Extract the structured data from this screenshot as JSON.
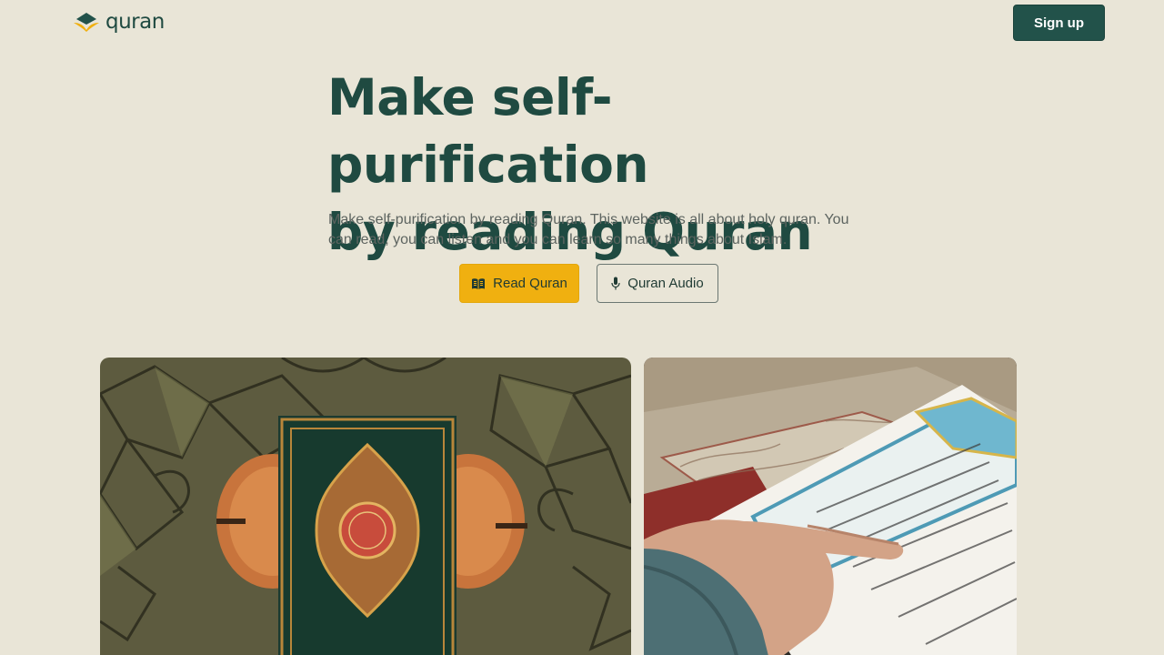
{
  "header": {
    "logo_text": "quran",
    "signup_label": "Sign up"
  },
  "hero": {
    "title_line1": "Make self-purification",
    "title_line2": "by reading Quran",
    "description": "Make self-purification by reading Quran. This website is all about holy quran. You can read, you can listen and you can learn so many things about Islam."
  },
  "actions": {
    "read_label": "Read Quran",
    "read_icon": "book-open-icon",
    "audio_label": "Quran Audio",
    "audio_icon": "microphone-icon"
  },
  "gallery": {
    "left_image": "quran-book-on-rug-photo",
    "right_image": "hand-reading-quran-photo"
  },
  "colors": {
    "background": "#e9e5d7",
    "primary": "#22524a",
    "accent": "#f0b010",
    "text_muted": "#5d6460"
  }
}
